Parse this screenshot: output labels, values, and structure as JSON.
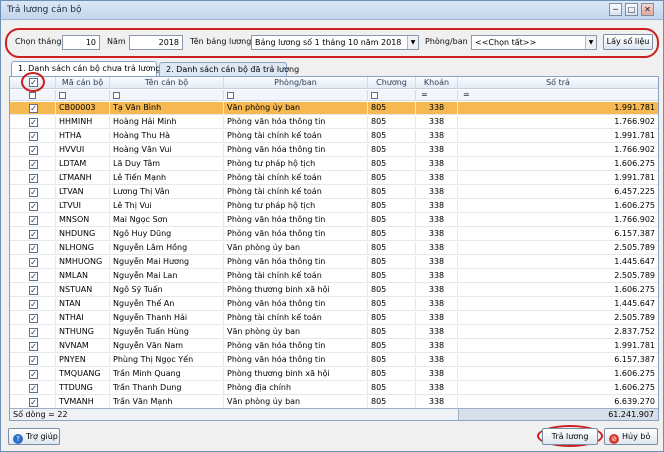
{
  "window": {
    "title": "Trả lương cán bộ",
    "minimize": "─",
    "maximize": "□",
    "close": "✕"
  },
  "filter": {
    "month_label": "Chọn tháng",
    "month_value": "10",
    "year_label": "Năm",
    "year_value": "2018",
    "payroll_label": "Tên bảng lương",
    "payroll_value": "Bảng lương số 1 tháng 10 năm 2018",
    "dept_label": "Phòng/ban",
    "dept_value": "<<Chọn tất>>",
    "fetch_button": "Lấy số liệu"
  },
  "tabs": [
    {
      "label": "1. Danh sách cán bộ chưa trả lương",
      "active": true
    },
    {
      "label": "2. Danh sách cán bộ đã trả lương",
      "active": false
    }
  ],
  "grid": {
    "columns": [
      "Mã cán bộ",
      "Tên cán bộ",
      "Phòng/ban",
      "Chương",
      "Khoản",
      "Số trả"
    ],
    "filter_ops": [
      "=",
      "="
    ],
    "check_mark": "✓",
    "rows": [
      {
        "code": "CB00003",
        "name": "Tạ Văn Bình",
        "dept": "Văn phòng ủy ban",
        "chuong": "805",
        "khoan": "338",
        "amount": "1.991.781"
      },
      {
        "code": "HHMINH",
        "name": "Hoàng Hải Minh",
        "dept": "Phòng văn hóa thông tin",
        "chuong": "805",
        "khoan": "338",
        "amount": "1.766.902"
      },
      {
        "code": "HTHA",
        "name": "Hoàng Thu Hà",
        "dept": "Phòng tài chính kế toán",
        "chuong": "805",
        "khoan": "338",
        "amount": "1.991.781"
      },
      {
        "code": "HVVUI",
        "name": "Hoàng Văn Vui",
        "dept": "Phòng văn hóa thông tin",
        "chuong": "805",
        "khoan": "338",
        "amount": "1.766.902"
      },
      {
        "code": "LDTAM",
        "name": "Lã Duy Tâm",
        "dept": "Phòng tư pháp hộ tịch",
        "chuong": "805",
        "khoan": "338",
        "amount": "1.606.275"
      },
      {
        "code": "LTMANH",
        "name": "Lê Tiến Mạnh",
        "dept": "Phòng tài chính kế toán",
        "chuong": "805",
        "khoan": "338",
        "amount": "1.991.781"
      },
      {
        "code": "LTVAN",
        "name": "Lương Thị Vân",
        "dept": "Phòng tài chính kế toán",
        "chuong": "805",
        "khoan": "338",
        "amount": "6.457.225"
      },
      {
        "code": "LTVUI",
        "name": "Lê Thị Vui",
        "dept": "Phòng tư pháp hộ tịch",
        "chuong": "805",
        "khoan": "338",
        "amount": "1.606.275"
      },
      {
        "code": "MNSON",
        "name": "Mai Ngọc Sơn",
        "dept": "Phòng văn hóa thông tin",
        "chuong": "805",
        "khoan": "338",
        "amount": "1.766.902"
      },
      {
        "code": "NHDUNG",
        "name": "Ngô Huy Dũng",
        "dept": "Phòng văn hóa thông tin",
        "chuong": "805",
        "khoan": "338",
        "amount": "6.157.387"
      },
      {
        "code": "NLHONG",
        "name": "Nguyễn Lâm Hồng",
        "dept": "Văn phòng ủy ban",
        "chuong": "805",
        "khoan": "338",
        "amount": "2.505.789"
      },
      {
        "code": "NMHUONG",
        "name": "Nguyễn Mai Hương",
        "dept": "Phòng văn hóa thông tin",
        "chuong": "805",
        "khoan": "338",
        "amount": "1.445.647"
      },
      {
        "code": "NMLAN",
        "name": "Nguyễn Mai Lan",
        "dept": "Phòng tài chính kế toán",
        "chuong": "805",
        "khoan": "338",
        "amount": "2.505.789"
      },
      {
        "code": "NSTUAN",
        "name": "Ngô Sỹ Tuấn",
        "dept": "Phòng thương binh xã hội",
        "chuong": "805",
        "khoan": "338",
        "amount": "1.606.275"
      },
      {
        "code": "NTAN",
        "name": "Nguyễn Thế An",
        "dept": "Phòng văn hóa thông tin",
        "chuong": "805",
        "khoan": "338",
        "amount": "1.445.647"
      },
      {
        "code": "NTHAI",
        "name": "Nguyễn Thanh Hải",
        "dept": "Phòng tài chính kế toán",
        "chuong": "805",
        "khoan": "338",
        "amount": "2.505.789"
      },
      {
        "code": "NTHUNG",
        "name": "Nguyễn Tuấn Hùng",
        "dept": "Văn phòng ủy ban",
        "chuong": "805",
        "khoan": "338",
        "amount": "2.837.752"
      },
      {
        "code": "NVNAM",
        "name": "Nguyễn Văn Nam",
        "dept": "Phòng văn hóa thông tin",
        "chuong": "805",
        "khoan": "338",
        "amount": "1.991.781"
      },
      {
        "code": "PNYEN",
        "name": "Phùng Thị Ngọc Yến",
        "dept": "Phòng văn hóa thông tin",
        "chuong": "805",
        "khoan": "338",
        "amount": "6.157.387"
      },
      {
        "code": "TMQUANG",
        "name": "Trần Minh Quang",
        "dept": "Phòng thương binh xã hội",
        "chuong": "805",
        "khoan": "338",
        "amount": "1.606.275"
      },
      {
        "code": "TTDUNG",
        "name": "Trần Thanh Dung",
        "dept": "Phòng địa chính",
        "chuong": "805",
        "khoan": "338",
        "amount": "1.606.275"
      },
      {
        "code": "TVMANH",
        "name": "Trần Văn Mạnh",
        "dept": "Văn phòng ủy ban",
        "chuong": "805",
        "khoan": "338",
        "amount": "6.639.270"
      }
    ],
    "selected_index": 0,
    "footer_count_label": "Số dòng = 22",
    "footer_total": "61.241.907"
  },
  "buttons": {
    "help": "Trợ giúp",
    "pay": "Trả lương",
    "cancel": "Hủy bỏ"
  },
  "colors": {
    "highlight_circle": "#cc1f1f",
    "selected_row": "#f6b850"
  }
}
